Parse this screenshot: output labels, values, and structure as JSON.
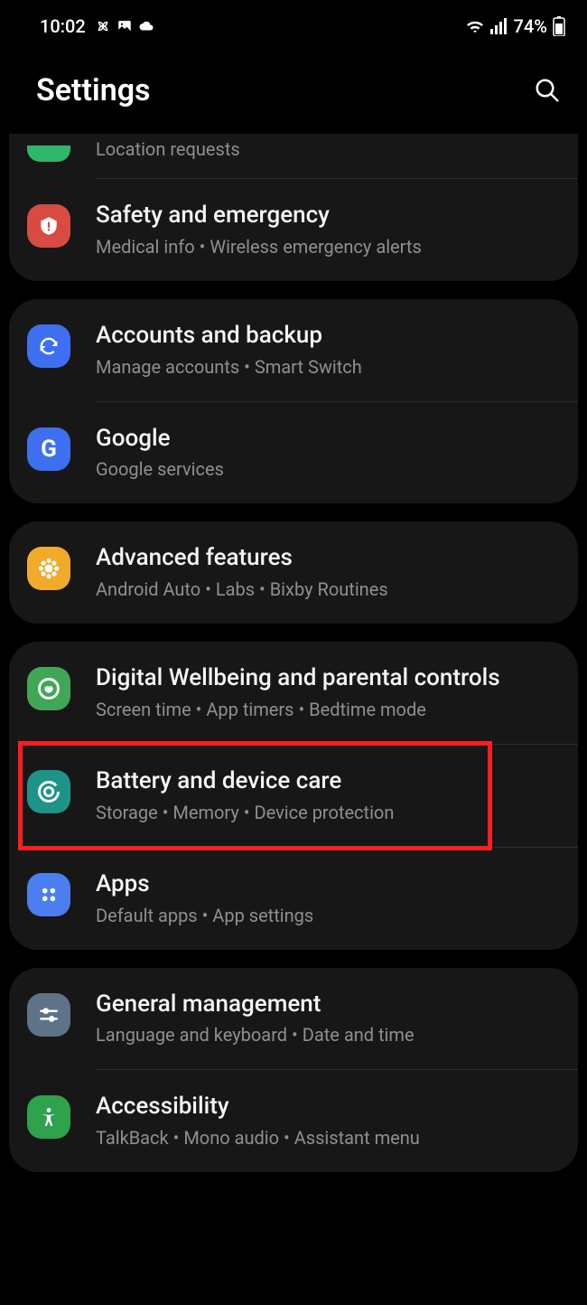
{
  "status": {
    "time": "10:02",
    "battery": "74%"
  },
  "header": {
    "title": "Settings"
  },
  "groups": [
    {
      "partial": true,
      "items": [
        {
          "title": "",
          "sub": "Location requests",
          "partial": true
        },
        {
          "title": "Safety and emergency",
          "sub": "Medical info  •  Wireless emergency alerts"
        }
      ]
    },
    {
      "items": [
        {
          "title": "Accounts and backup",
          "sub": "Manage accounts  •  Smart Switch"
        },
        {
          "title": "Google",
          "sub": "Google services"
        }
      ]
    },
    {
      "items": [
        {
          "title": "Advanced features",
          "sub": "Android Auto  •  Labs  •  Bixby Routines"
        }
      ]
    },
    {
      "items": [
        {
          "title": "Digital Wellbeing and parental controls",
          "sub": "Screen time  •  App timers  •  Bedtime mode"
        },
        {
          "title": "Battery and device care",
          "sub": "Storage  •  Memory  •  Device protection",
          "highlight": true
        },
        {
          "title": "Apps",
          "sub": "Default apps  •  App settings"
        }
      ]
    },
    {
      "items": [
        {
          "title": "General management",
          "sub": "Language and keyboard  •  Date and time"
        },
        {
          "title": "Accessibility",
          "sub": "TalkBack  •  Mono audio  •  Assistant menu"
        }
      ]
    }
  ]
}
